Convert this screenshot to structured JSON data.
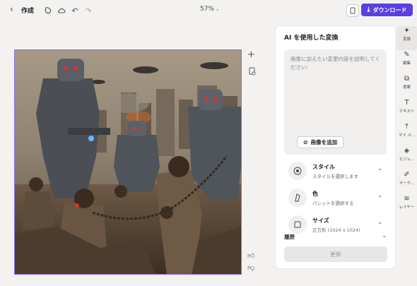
{
  "topbar": {
    "back_icon": "chevron-left-icon",
    "title": "作成",
    "zoom": "57%",
    "download_label": "ダウンロード"
  },
  "panel": {
    "title": "AI を使用した変換",
    "prompt_placeholder": "画像に加えたい変更内容を説明してください:",
    "add_image_label": "画像を追加",
    "options": [
      {
        "label": "スタイル",
        "sub": "スタイルを選択します",
        "icon": "style-icon"
      },
      {
        "label": "色",
        "sub": "パレットを選択する",
        "icon": "palette-icon"
      },
      {
        "label": "サイズ",
        "sub": "正方形 (1024 x 1024)",
        "icon": "size-icon"
      }
    ],
    "history_label": "履歴",
    "update_label": "更新"
  },
  "rail": {
    "items": [
      {
        "label": "変換",
        "icon": "sparkle-icon"
      },
      {
        "label": "編集",
        "icon": "pencil-icon"
      },
      {
        "label": "提案",
        "icon": "shapes-icon"
      },
      {
        "label": "テキスト",
        "icon": "text-icon"
      },
      {
        "label": "マイ メ...",
        "icon": "upload-icon"
      },
      {
        "label": "ビジュ...",
        "icon": "visuals-icon"
      },
      {
        "label": "マーク...",
        "icon": "pen-icon"
      },
      {
        "label": "レイヤー",
        "icon": "layers-icon"
      }
    ]
  },
  "colors": {
    "accent": "#5b3fe0",
    "selection": "#8b6cf6",
    "background": "#f3f2f1"
  }
}
